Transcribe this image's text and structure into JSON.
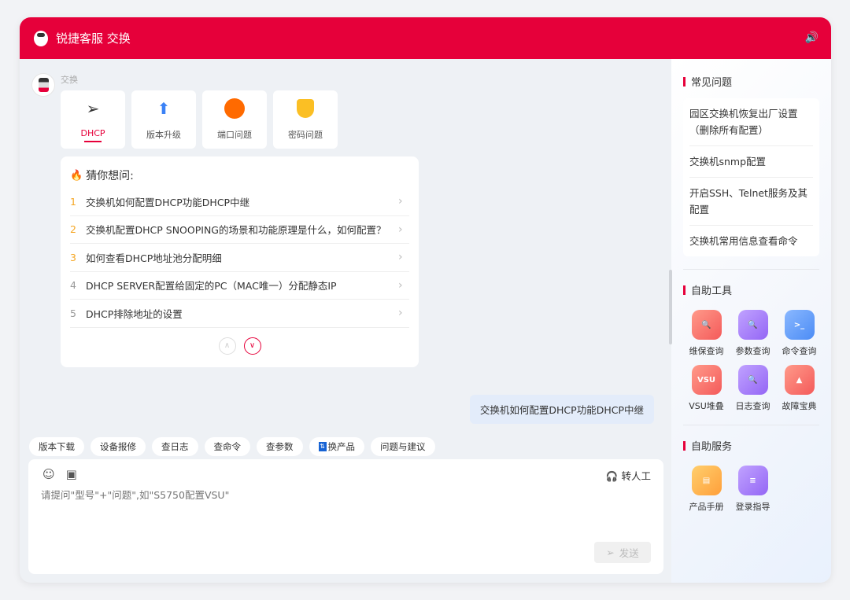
{
  "header": {
    "title": "锐捷客服 交换",
    "speaker_icon": "speaker-icon"
  },
  "chat": {
    "sender": "交换",
    "categories": [
      {
        "label": "DHCP",
        "icon": "send-icon"
      },
      {
        "label": "版本升级",
        "icon": "upgrade-icon"
      },
      {
        "label": "端口问题",
        "icon": "port-icon"
      },
      {
        "label": "密码问题",
        "icon": "key-shield-icon"
      }
    ],
    "guess": {
      "title": "猜你想问:",
      "items": [
        {
          "n": "1",
          "text": "交换机如何配置DHCP功能DHCP中继"
        },
        {
          "n": "2",
          "text": "交换机配置DHCP SNOOPING的场景和功能原理是什么，如何配置？"
        },
        {
          "n": "3",
          "text": "如何查看DHCP地址池分配明细"
        },
        {
          "n": "4",
          "text": "DHCP SERVER配置给固定的PC（MAC唯一）分配静态IP"
        },
        {
          "n": "5",
          "text": "DHCP排除地址的设置"
        }
      ]
    },
    "user_message": "交换机如何配置DHCP功能DHCP中继"
  },
  "chips": [
    "版本下载",
    "设备报修",
    "查日志",
    "查命令",
    "查参数",
    "换产品",
    "问题与建议"
  ],
  "input": {
    "placeholder": "请提问\"型号\"+\"问题\",如\"S5750配置VSU\"",
    "human_label": "转人工",
    "send_label": "发送"
  },
  "side": {
    "faq_title": "常见问题",
    "faq": [
      "园区交换机恢复出厂设置（删除所有配置）",
      "交换机snmp配置",
      "开启SSH、Telnet服务及其配置",
      "交换机常用信息查看命令"
    ],
    "tools_title": "自助工具",
    "tools": [
      "维保查询",
      "参数查询",
      "命令查询",
      "VSU堆叠",
      "日志查询",
      "故障宝典"
    ],
    "services_title": "自助服务",
    "services": [
      "产品手册",
      "登录指导"
    ]
  }
}
